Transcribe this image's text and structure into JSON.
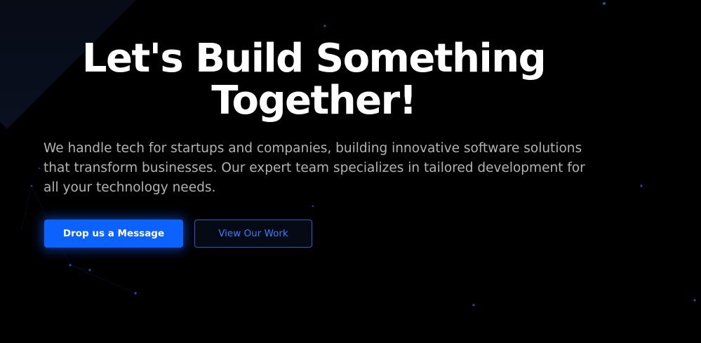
{
  "hero": {
    "title_line1": "Let's Build Something",
    "title_line2": "Together!",
    "description": "We handle tech for startups and companies, building innovative software solutions that transform businesses. Our expert team specializes in tailored development for all your technology needs.",
    "primary_button_label": "Drop us a Message",
    "secondary_button_label": "View Our Work"
  },
  "colors": {
    "background": "#000000",
    "accent": "#0b62ff",
    "heading": "#ffffff",
    "body_text": "#b3b3b3"
  }
}
